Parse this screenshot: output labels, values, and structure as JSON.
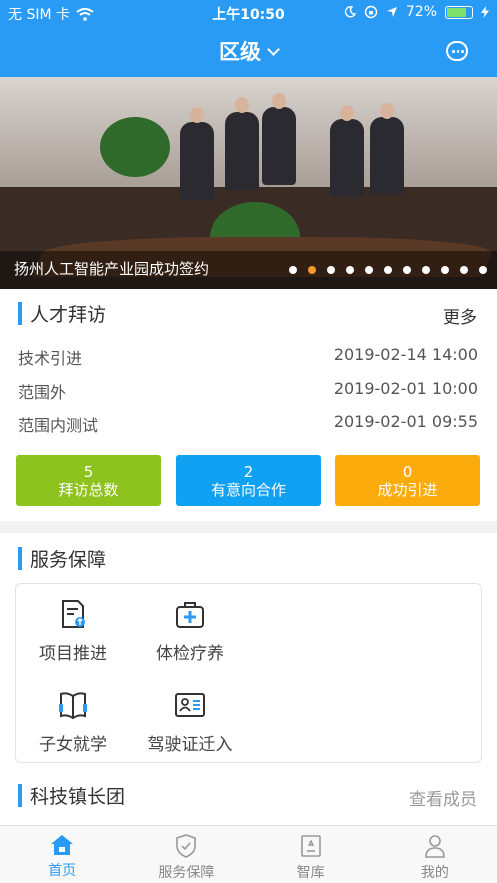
{
  "status_bar": {
    "carrier": "无 SIM 卡",
    "time": "上午10:50",
    "battery": "72%"
  },
  "nav": {
    "title": "区级",
    "message_icon": "message-icon"
  },
  "banner": {
    "caption": "扬州人工智能产业园成功签约",
    "dot_count": 11,
    "active_dot": 1
  },
  "talent_visit": {
    "title": "人才拜访",
    "more": "更多",
    "items": [
      {
        "name": "技术引进",
        "time": "2019-02-14 14:00"
      },
      {
        "name": "范围外",
        "time": "2019-02-01 10:00"
      },
      {
        "name": "范围内测试",
        "time": "2019-02-01 09:55"
      }
    ],
    "stats": [
      {
        "value": "5",
        "label": "拜访总数",
        "color": "#8dc21f"
      },
      {
        "value": "2",
        "label": "有意向合作",
        "color": "#11a1f2"
      },
      {
        "value": "0",
        "label": "成功引进",
        "color": "#fbab0b"
      }
    ]
  },
  "service": {
    "title": "服务保障",
    "items": [
      {
        "label": "项目推进",
        "icon": "project-icon"
      },
      {
        "label": "体检疗养",
        "icon": "medical-kit-icon"
      },
      {
        "label": "子女就学",
        "icon": "book-icon"
      },
      {
        "label": "驾驶证迁入",
        "icon": "id-card-icon"
      }
    ]
  },
  "tech_team": {
    "title": "科技镇长团",
    "more": "查看成员"
  },
  "tabbar": {
    "tabs": [
      {
        "label": "首页",
        "icon": "home-icon",
        "active": true
      },
      {
        "label": "服务保障",
        "icon": "shield-icon",
        "active": false
      },
      {
        "label": "智库",
        "icon": "library-icon",
        "active": false
      },
      {
        "label": "我的",
        "icon": "user-icon",
        "active": false
      }
    ]
  },
  "colors": {
    "primary": "#2a9bf5",
    "accent_dot": "#f39a2b"
  }
}
